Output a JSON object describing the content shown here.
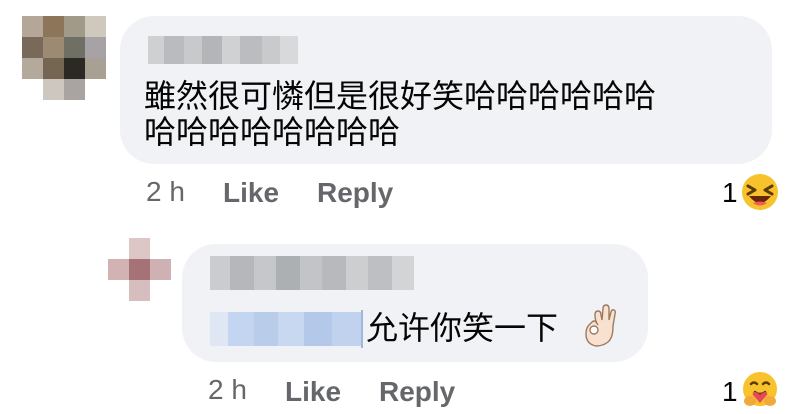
{
  "comments": [
    {
      "text_line1": "雖然很可憐但是很好笑哈哈哈哈哈哈",
      "text_line2": "哈哈哈哈哈哈哈哈",
      "time": "2 h",
      "like_label": "Like",
      "reply_label": "Reply",
      "reaction_count": "1",
      "reaction_icon": "laughing-face-icon"
    },
    {
      "text": "允许你笑一下",
      "inline_emoji": "ok-hand-icon",
      "time": "2 h",
      "like_label": "Like",
      "reply_label": "Reply",
      "reaction_count": "1",
      "reaction_icon": "care-hug-face-icon"
    }
  ],
  "colors": {
    "bubble": "#f0f2f5",
    "meta_text": "#65676b",
    "body_text": "#050505",
    "mention_blur": "#c7d8f2"
  }
}
